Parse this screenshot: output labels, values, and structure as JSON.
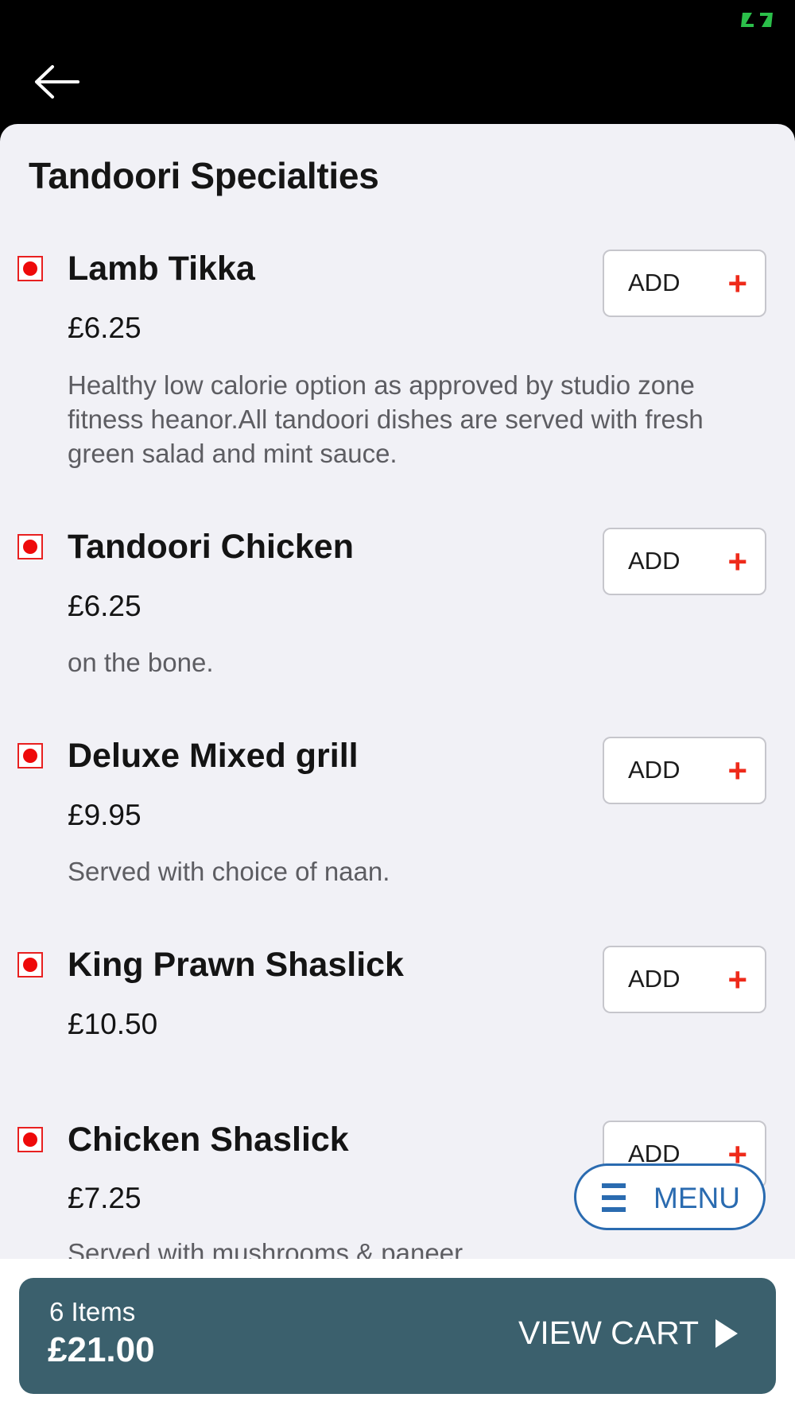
{
  "section": {
    "title": "Tandoori Specialties"
  },
  "items": [
    {
      "name": "Lamb Tikka",
      "price": "£6.25",
      "description": "Healthy low calorie option as approved by studio zone fitness heanor.All tandoori dishes are served with fresh green salad and mint sauce.",
      "add_label": "ADD",
      "add_icon": "+"
    },
    {
      "name": "Tandoori Chicken",
      "price": "£6.25",
      "description": "on the bone.",
      "add_label": "ADD",
      "add_icon": "+"
    },
    {
      "name": "Deluxe Mixed grill",
      "price": "£9.95",
      "description": "Served with choice of naan.",
      "add_label": "ADD",
      "add_icon": "+"
    },
    {
      "name": "King Prawn Shaslick",
      "price": "£10.50",
      "description": "",
      "add_label": "ADD",
      "add_icon": "+"
    },
    {
      "name": "Chicken Shaslick",
      "price": "£7.25",
      "description": "Served with mushrooms & paneer",
      "add_label": "ADD",
      "add_icon": "+"
    }
  ],
  "menu_button": {
    "label": "MENU",
    "icon": "hamburger-icon"
  },
  "cart": {
    "count_label": "6 Items",
    "total": "£21.00",
    "view_label": "VIEW CART",
    "icon": "play-arrow-icon"
  },
  "colors": {
    "accent_red": "#ee2a1a",
    "menu_blue": "#2a6bb0",
    "cart_bar": "#3b606d",
    "background": "#f1f1f6"
  }
}
